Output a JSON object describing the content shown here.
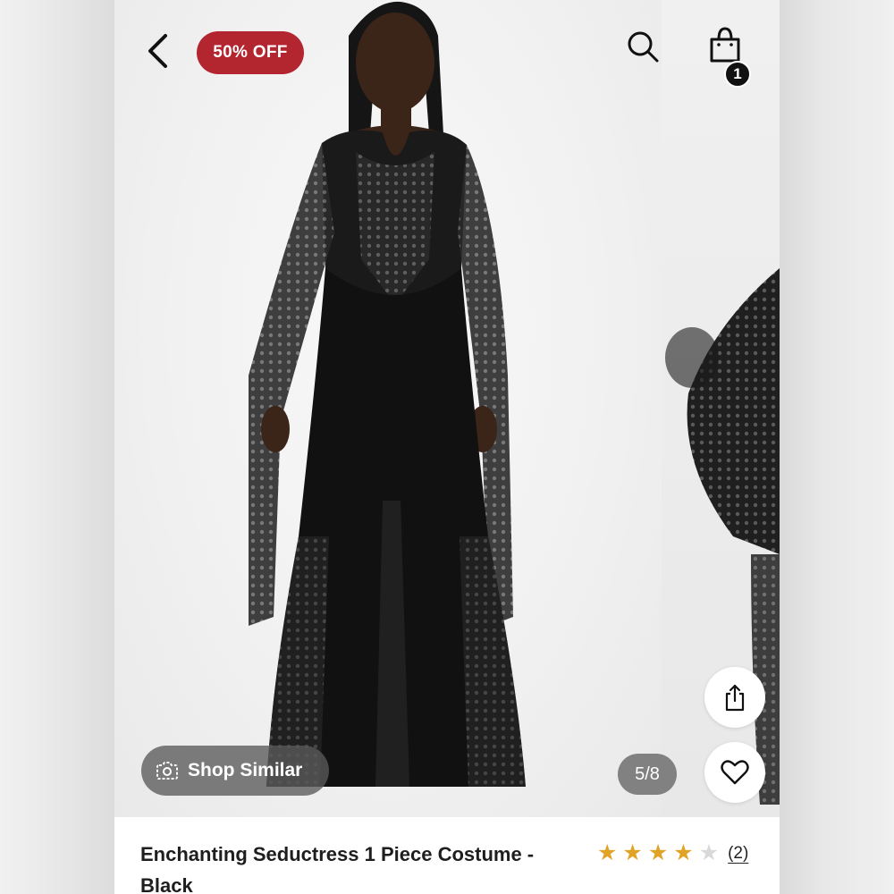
{
  "header": {
    "discount_badge": "50% OFF",
    "cart_count": "1"
  },
  "gallery": {
    "shop_similar_label": "Shop Similar",
    "page_indicator": "5/8"
  },
  "product": {
    "title": "Enchanting Seductress 1 Piece Costume - Black",
    "rating": 4,
    "rating_max": 5,
    "review_count": "(2)"
  },
  "colors": {
    "badge": "#b3262f",
    "star_filled": "#e0a326",
    "star_empty": "#d9d9d9"
  },
  "icons": [
    "back-chevron-icon",
    "search-icon",
    "shopping-bag-icon",
    "camera-icon",
    "share-icon",
    "heart-icon",
    "star-icon"
  ]
}
